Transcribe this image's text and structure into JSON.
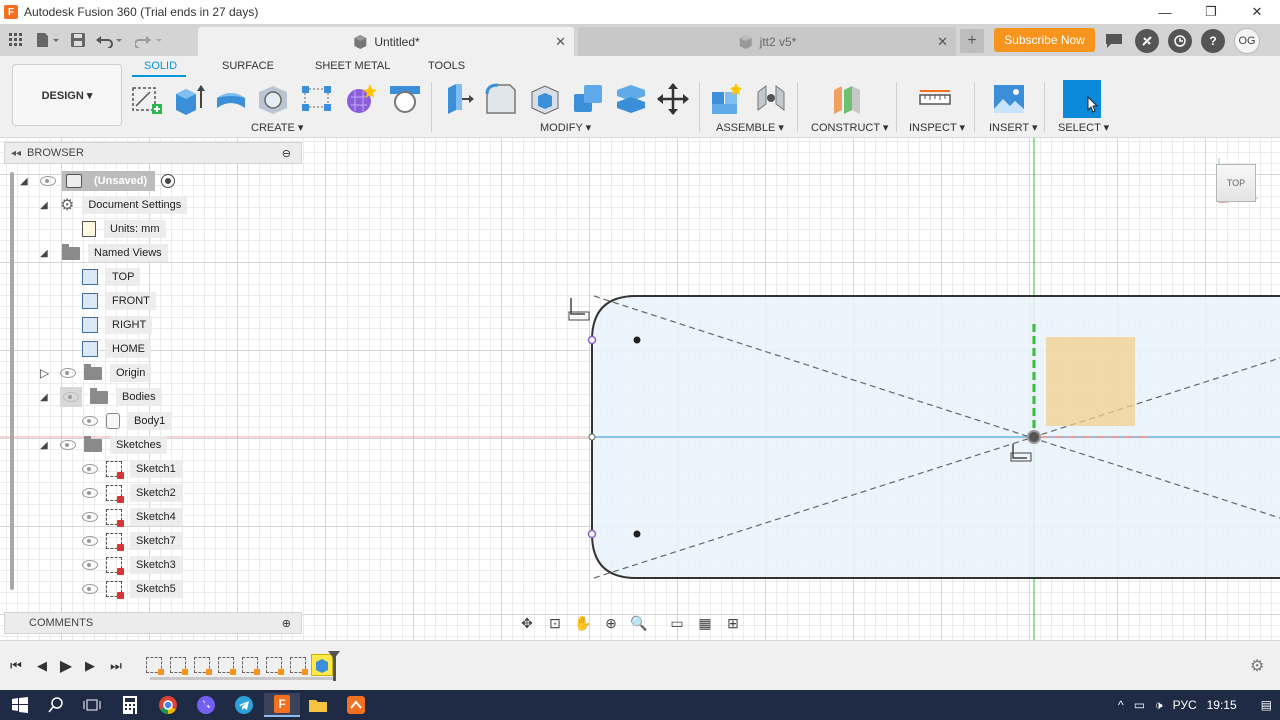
{
  "window": {
    "title": "Autodesk Fusion 360 (Trial ends in 27 days)",
    "minimize": "—",
    "maximize": "❐",
    "close": "✕"
  },
  "tabs": {
    "active_label": "Untitled*",
    "inactive_label": "jtt2 v5*",
    "close_glyph": "✕",
    "new_tab": "+",
    "subscribe": "Subscribe Now",
    "avatar": "OG"
  },
  "ribbon": {
    "workspace": "DESIGN ▾",
    "tabs": [
      "SOLID",
      "SURFACE",
      "SHEET METAL",
      "TOOLS"
    ],
    "groups": [
      "CREATE ▾",
      "MODIFY ▾",
      "ASSEMBLE ▾",
      "CONSTRUCT ▾",
      "INSPECT ▾",
      "INSERT ▾",
      "SELECT ▾"
    ]
  },
  "browser": {
    "header": "BROWSER",
    "root": "(Unsaved)",
    "document_settings": "Document Settings",
    "units": "Units: mm",
    "named_views": "Named Views",
    "views": [
      "TOP",
      "FRONT",
      "RIGHT",
      "HOME"
    ],
    "origin": "Origin",
    "bodies": "Bodies",
    "body1": "Body1",
    "sketches_label": "Sketches",
    "sketches": [
      "Sketch1",
      "Sketch2",
      "Sketch4",
      "Sketch7",
      "Sketch3",
      "Sketch5"
    ]
  },
  "comments": {
    "header": "COMMENTS"
  },
  "viewcube": {
    "face": "TOP"
  },
  "taskbar": {
    "language": "РУС",
    "time": "19:15"
  },
  "colors": {
    "accent": "#0696d7",
    "subscribe": "#f7941d",
    "sketch_fill": "#eaf3fb",
    "profile_fill": "#f2cf8f",
    "origin_blue": "#6ab4e8",
    "origin_red": "#f2a8a8",
    "origin_green": "#30c030"
  }
}
